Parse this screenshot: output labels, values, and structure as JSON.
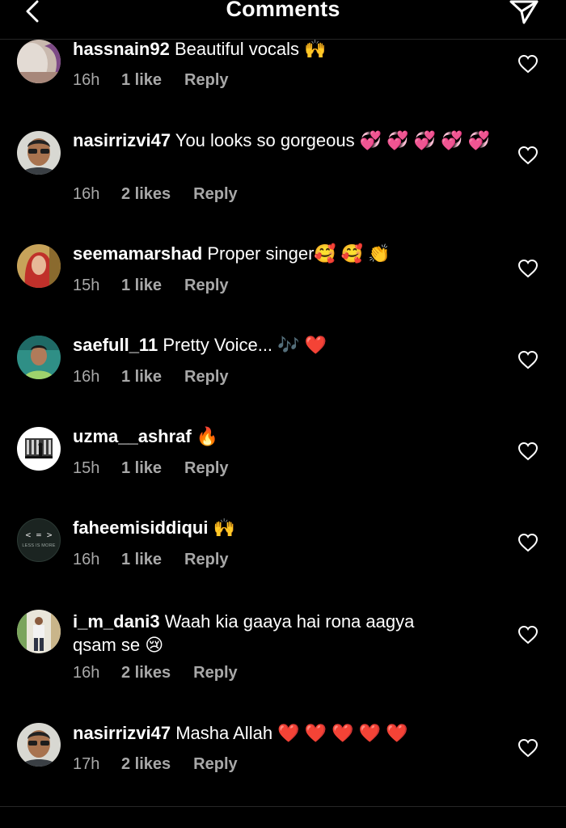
{
  "header": {
    "title": "Comments",
    "back_icon": "chevron-left-icon",
    "send_icon": "paper-plane-icon"
  },
  "comments": [
    {
      "username": "hassnain92",
      "text": "Beautiful vocals 🙌",
      "time": "16h",
      "likes": "1 like",
      "reply": "Reply",
      "avatar": "photo-purple"
    },
    {
      "username": "nasirrizvi47",
      "text": "You looks so gorgeous 💞 💞 💞 💞 💞",
      "time": "16h",
      "likes": "2 likes",
      "reply": "Reply",
      "avatar": "man-sunglasses"
    },
    {
      "username": "seemamarshad",
      "text": "Proper singer🥰 🥰 👏",
      "time": "15h",
      "likes": "1 like",
      "reply": "Reply",
      "avatar": "woman-portrait"
    },
    {
      "username": "saefull_11",
      "text": "Pretty Voice... 🎶 ❤️",
      "time": "16h",
      "likes": "1 like",
      "reply": "Reply",
      "avatar": "man-teal"
    },
    {
      "username": "uzma__ashraf",
      "text": "🔥",
      "time": "15h",
      "likes": "1 like",
      "reply": "Reply",
      "avatar": "silhouette-white"
    },
    {
      "username": "faheemisiddiqui",
      "text": "🙌",
      "time": "16h",
      "likes": "1 like",
      "reply": "Reply",
      "avatar": "less-is-more"
    },
    {
      "username": "i_m_dani3",
      "text": "Waah kia gaaya hai rona aagya qsam se 😢",
      "time": "16h",
      "likes": "2 likes",
      "reply": "Reply",
      "avatar": "man-standing"
    },
    {
      "username": "nasirrizvi47",
      "text": "Masha Allah ❤️ ❤️ ❤️ ❤️ ❤️",
      "time": "17h",
      "likes": "2 likes",
      "reply": "Reply",
      "avatar": "man-sunglasses"
    }
  ],
  "avatar_badge": {
    "code": "< = >",
    "caption": "LESS IS MORE"
  },
  "colors": {
    "background": "#000000",
    "text": "#ffffff",
    "muted": "#a8a8a8",
    "divider": "#262626"
  },
  "heart_icon": "heart-outline-icon"
}
